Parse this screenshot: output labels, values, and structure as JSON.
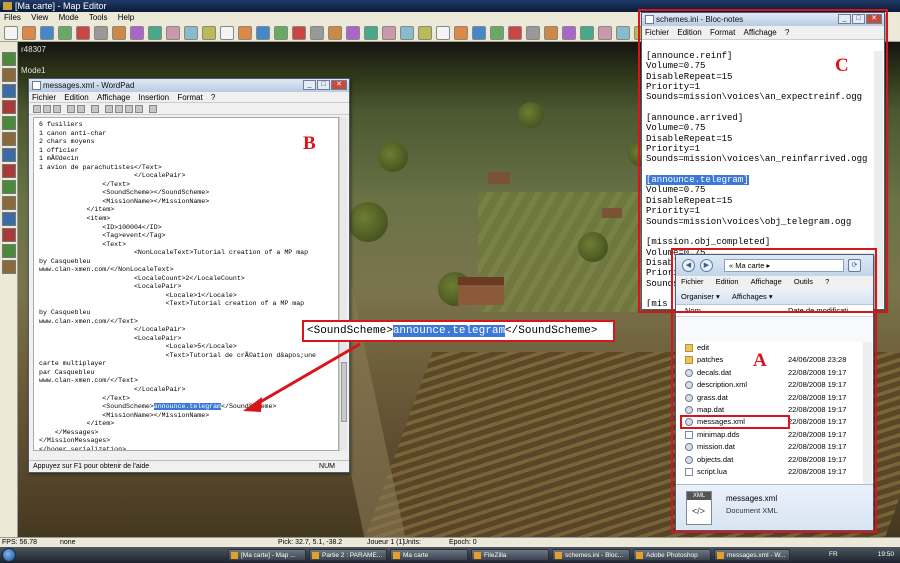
{
  "app": {
    "title": "[Ma carte] - Map Editor",
    "menu": [
      "Files",
      "View",
      "Mode",
      "Tools",
      "Help"
    ]
  },
  "hud": {
    "id": "r48307",
    "mode": "Mode1"
  },
  "wordpad": {
    "title": "messages.xml - WordPad",
    "menu": [
      "Fichier",
      "Edition",
      "Affichage",
      "Insertion",
      "Format",
      "?"
    ],
    "lines": [
      "6 fusiliers",
      "1 canon anti-char",
      "2 chars moyens",
      "1 officier",
      "1 mÃ©decin",
      "1 avion de parachutistes</Text>",
      "                        </LocalePair>",
      "                </Text>",
      "                <SoundScheme></SoundScheme>",
      "                <MissionName></MissionName>",
      "            </item>",
      "            <item>",
      "                <ID>100004</ID>",
      "                <Tag>event</Tag>",
      "                <Text>",
      "                        <NonLocaleText>Tutorial creation of a MP map",
      "by Casquebleu",
      "www.clan-xmen.com/</NonLocaleText>",
      "                        <LocaleCount>2</LocaleCount>",
      "                        <LocalePair>",
      "                                <Locale>1</Locale>",
      "                                <Text>Tutorial creation of a MP map",
      "by Casquebleu",
      "www.clan-xmen.com/</Text>",
      "                        </LocalePair>",
      "                        <LocalePair>",
      "                                <Locale>5</Locale>",
      "                                <Text>Tutorial de crÃ©ation d&apos;une",
      "carte multiplayer",
      "par Casquebleu",
      "www.clan-xmen.com/</Text>",
      "                        </LocalePair>",
      "                </Text>",
      "                <SoundScheme>",
      "                <MissionName></MissionName>",
      "            </item>",
      "    </Messages>",
      "</MissionMessages>",
      "</hoger_serialization>"
    ],
    "highlight_value": "announce.telegram",
    "soundscheme_close": "</SoundScheme>",
    "status": "Appuyez sur F1 pour obtenir de l'aide",
    "num": "NUM"
  },
  "notepad": {
    "title": "schemes.ini - Bloc-notes",
    "menu": [
      "Fichier",
      "Edition",
      "Format",
      "Affichage",
      "?"
    ],
    "lines": [
      "[announce.reinf]",
      "Volume=0.75",
      "DisableRepeat=15",
      "Priority=1",
      "Sounds=mission\\voices\\an_expectreinf.ogg",
      "",
      "[announce.arrived]",
      "Volume=0.75",
      "DisableRepeat=15",
      "Priority=1",
      "Sounds=mission\\voices\\an_reinfarrived.ogg",
      "",
      "[announce.telegram]",
      "Volume=0.75",
      "DisableRepeat=15",
      "Priority=1",
      "Sounds=mission\\voices\\obj_telegram.ogg",
      "",
      "[mission.obj_completed]",
      "Volume=0.75",
      "DisableRepeat=10",
      "Priority=1",
      "Sounds=mission\\voices\\obj_done.ogg",
      "",
      "[mis",
      "Volu",
      "Disa",
      "Prio",
      "Sour"
    ]
  },
  "explorer": {
    "path": "« Ma carte ▸",
    "menu": [
      "Fichier",
      "Edition",
      "Affichage",
      "Outils",
      "?"
    ],
    "toolbar": [
      "Organiser ▾",
      "Affichages ▾"
    ],
    "columns": [
      "Nom",
      "Date de modificati..."
    ],
    "files": [
      {
        "name": "edit",
        "date": "",
        "icon": "folder"
      },
      {
        "name": "patches",
        "date": "24/06/2008 23:28",
        "icon": "folder"
      },
      {
        "name": "decals.dat",
        "date": "22/08/2008 19:17",
        "icon": "gear"
      },
      {
        "name": "description.xml",
        "date": "22/08/2008 19:17",
        "icon": "gear"
      },
      {
        "name": "grass.dat",
        "date": "22/08/2008 19:17",
        "icon": "gear"
      },
      {
        "name": "map.dat",
        "date": "22/08/2008 19:17",
        "icon": "gear"
      },
      {
        "name": "messages.xml",
        "date": "22/08/2008 19:17",
        "icon": "gear"
      },
      {
        "name": "minimap.dds",
        "date": "22/08/2008 19:17",
        "icon": "file"
      },
      {
        "name": "mission.dat",
        "date": "22/08/2008 19:17",
        "icon": "gear"
      },
      {
        "name": "objects.dat",
        "date": "22/08/2008 19:17",
        "icon": "gear"
      },
      {
        "name": "script.lua",
        "date": "22/08/2008 19:17",
        "icon": "file"
      }
    ],
    "detail_name": "messages.xml",
    "detail_type": "Document XML",
    "xml_tag": "XML"
  },
  "annotations": {
    "A": "A",
    "B": "B",
    "C": "C",
    "callout_open": "<SoundScheme>",
    "callout_value": "announce.telegram",
    "callout_close": "</SoundScheme>"
  },
  "appstatus": {
    "fps": "FPS: 56.78",
    "mode": "none",
    "pick": "Pick: 32.7, 5.1, -38.2",
    "player": "Joueur 1 (1)",
    "units": "Units:",
    "epoch": "Epoch: 0"
  },
  "taskbar": {
    "tasks": [
      "[Ma carte] - Map ...",
      "Partie 2 : PARAME...",
      "Ma carte",
      "FileZilla",
      "schemes.ini - Bloc...",
      "Adobe Photoshop",
      "messages.xml - W..."
    ],
    "lang": "FR",
    "clock": "19:50"
  },
  "colors": {
    "annotation_red": "#d9151c",
    "selection_blue": "#3c78d8"
  }
}
